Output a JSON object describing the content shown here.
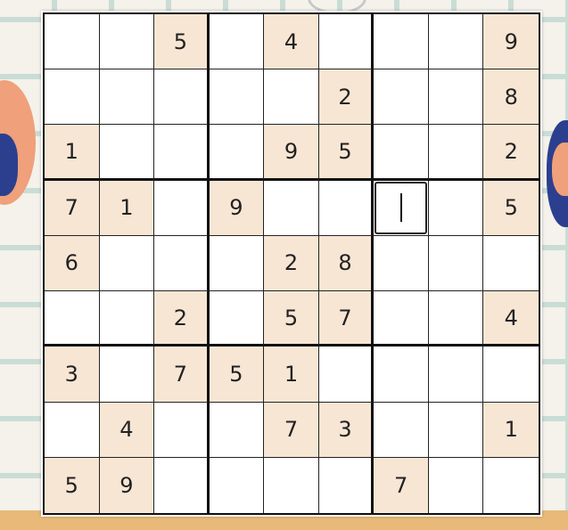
{
  "game": {
    "type": "sudoku",
    "grid": [
      [
        "",
        "",
        "5",
        "",
        "4",
        "",
        "",
        "",
        "9"
      ],
      [
        "",
        "",
        "",
        "",
        "",
        "2",
        "",
        "",
        "8"
      ],
      [
        "1",
        "",
        "",
        "",
        "9",
        "5",
        "",
        "",
        "2"
      ],
      [
        "7",
        "1",
        "",
        "9",
        "",
        "",
        "",
        "",
        "5"
      ],
      [
        "6",
        "",
        "",
        "",
        "2",
        "8",
        "",
        "",
        ""
      ],
      [
        "",
        "",
        "2",
        "",
        "5",
        "7",
        "",
        "",
        "4"
      ],
      [
        "3",
        "",
        "7",
        "5",
        "1",
        "",
        "",
        "",
        ""
      ],
      [
        "",
        "4",
        "",
        "",
        "7",
        "3",
        "",
        "",
        "1"
      ],
      [
        "5",
        "9",
        "",
        "",
        "",
        "",
        "7",
        "",
        ""
      ]
    ],
    "selected_cell": {
      "row": 4,
      "col": 7
    },
    "colors": {
      "given_cell": "#f8e6d4",
      "empty_cell": "#ffffff",
      "grid_line": "#222222"
    }
  }
}
